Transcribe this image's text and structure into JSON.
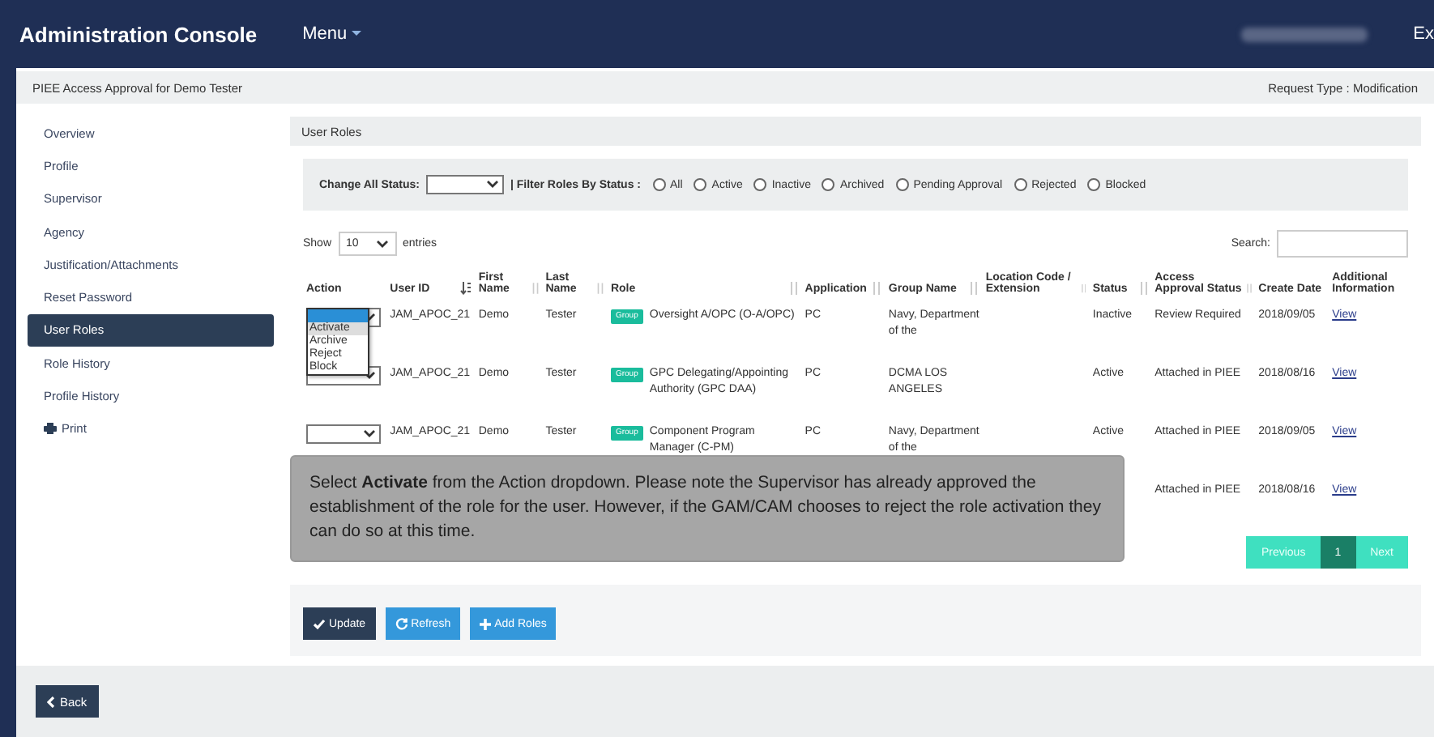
{
  "header": {
    "title": "Administration Console",
    "menu": "Menu",
    "cut_text": "Ex"
  },
  "page_bar": {
    "title": "PIEE Access Approval for Demo Tester",
    "request_type": "Request Type : Modification"
  },
  "sidebar": {
    "items": [
      {
        "label": "Overview",
        "kind": "link",
        "selected": false
      },
      {
        "label": "Profile",
        "kind": "link",
        "selected": false
      },
      {
        "label": "Supervisor",
        "kind": "link",
        "selected": false
      },
      {
        "label": "Agency",
        "kind": "link",
        "selected": false
      },
      {
        "label": "Justification/Attachments",
        "kind": "link",
        "selected": false
      },
      {
        "label": "Reset Password",
        "kind": "link",
        "selected": false
      },
      {
        "label": "User Roles",
        "kind": "link",
        "selected": true
      },
      {
        "label": "Role History",
        "kind": "link",
        "selected": false
      },
      {
        "label": "Profile History",
        "kind": "link",
        "selected": false
      },
      {
        "label": "Print",
        "kind": "print",
        "selected": false
      }
    ]
  },
  "panel": {
    "title": "User Roles",
    "filter": {
      "change_all_label": "Change All Status:",
      "filter_label": "| Filter Roles By Status :",
      "options": [
        {
          "label": "All",
          "checked": false
        },
        {
          "label": "Active",
          "checked": false
        },
        {
          "label": "Inactive",
          "checked": false
        },
        {
          "label": "Archived",
          "checked": false
        },
        {
          "label": "Pending Approval",
          "checked": false
        },
        {
          "label": "Rejected",
          "checked": false
        },
        {
          "label": "Blocked",
          "checked": false
        }
      ]
    },
    "show_label": "Show",
    "page_size": "10",
    "entries_label": "entries",
    "search_label": "Search:",
    "table": {
      "columns": [
        {
          "label": "Action",
          "sortable": false,
          "sorted": false
        },
        {
          "label": "User ID",
          "sortable": true,
          "sorted": true
        },
        {
          "label": "First Name",
          "sortable": true,
          "sorted": false
        },
        {
          "label": "Last Name",
          "sortable": true,
          "sorted": false
        },
        {
          "label": "Role",
          "sortable": true,
          "sorted": false
        },
        {
          "label": "Application",
          "sortable": true,
          "sorted": false
        },
        {
          "label": "Group Name",
          "sortable": true,
          "sorted": false
        },
        {
          "label": "Location Code / Extension",
          "sortable": true,
          "sorted": false
        },
        {
          "label": "Status",
          "sortable": true,
          "sorted": false
        },
        {
          "label": "Access Approval Status",
          "sortable": true,
          "sorted": false
        },
        {
          "label": "Create Date",
          "sortable": false,
          "sorted": false
        },
        {
          "label": "Additional Information",
          "sortable": false,
          "sorted": false
        }
      ],
      "action_options": [
        {
          "label": "Activate",
          "highlighted": true
        },
        {
          "label": "Archive",
          "highlighted": false
        },
        {
          "label": "Reject",
          "highlighted": false
        },
        {
          "label": "Block",
          "highlighted": false
        }
      ],
      "rows": [
        {
          "action_open": true,
          "user_id": "JAM_APOC_21",
          "first": "Demo",
          "last": "Tester",
          "badge": "Group",
          "role": "Oversight A/OPC (O-A/OPC)",
          "application": "PC",
          "group": "Navy, Department of the",
          "status": "Inactive",
          "access_status": "Review Required",
          "create_date": "2018/09/05",
          "info": "View"
        },
        {
          "action_open": false,
          "user_id": "JAM_APOC_21",
          "first": "Demo",
          "last": "Tester",
          "badge": "Group",
          "role": "GPC Delegating/Appointing Authority (GPC DAA)",
          "application": "PC",
          "group": "DCMA LOS ANGELES",
          "status": "Active",
          "access_status": "Attached in PIEE",
          "create_date": "2018/08/16",
          "info": "View"
        },
        {
          "action_open": false,
          "user_id": "JAM_APOC_21",
          "first": "Demo",
          "last": "Tester",
          "badge": "Group",
          "role": "Component Program Manager (C-PM)",
          "application": "PC",
          "group": "Navy, Department of the",
          "status": "Active",
          "access_status": "Attached in PIEE",
          "create_date": "2018/09/05",
          "info": "View"
        },
        {
          "access_status": "Attached in PIEE",
          "create_date": "2018/08/16",
          "info": "View"
        }
      ]
    },
    "pagination": [
      {
        "label": "Previous",
        "selected": false
      },
      {
        "label": "1",
        "selected": true
      },
      {
        "label": "Next",
        "selected": false
      }
    ],
    "buttons": [
      {
        "label": "Update",
        "kind": "update"
      },
      {
        "label": "Refresh",
        "kind": "refresh"
      },
      {
        "label": "Add Roles",
        "kind": "add"
      }
    ],
    "tooltip": "Select **Activate** from the Action dropdown. Please note the Supervisor has already approved the establishment of the role for the user. However, if the GAM/CAM chooses to reject the role activation they can do so at this time."
  },
  "footer": {
    "back": "Back"
  }
}
